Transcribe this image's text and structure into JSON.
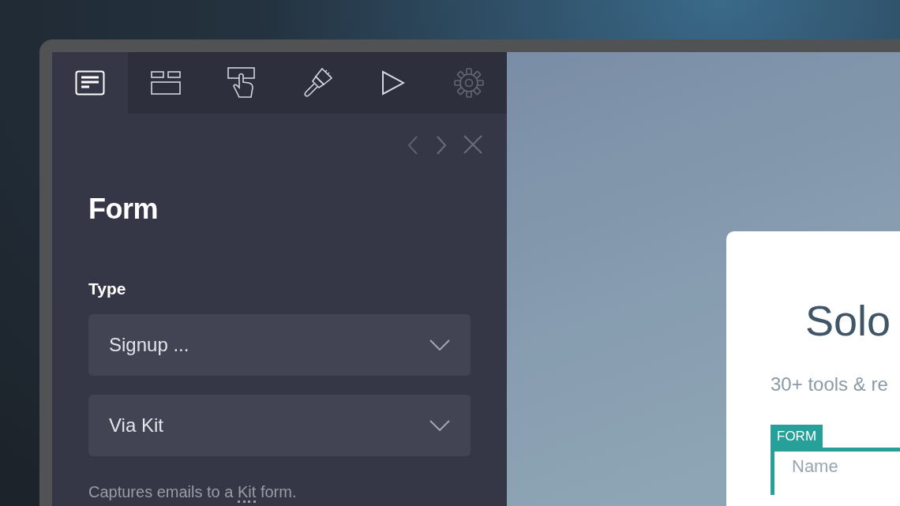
{
  "tabs": [
    {
      "kind": "form",
      "selected": true
    },
    {
      "kind": "layout",
      "selected": false
    },
    {
      "kind": "click",
      "selected": false
    },
    {
      "kind": "brush",
      "selected": false
    },
    {
      "kind": "play",
      "selected": false
    },
    {
      "kind": "settings",
      "selected": false
    }
  ],
  "panel": {
    "title": "Form",
    "type_label": "Type",
    "selects": [
      {
        "value": "Signup ..."
      },
      {
        "value": "Via Kit"
      }
    ],
    "description": {
      "before": "Captures emails to a ",
      "term": "Kit",
      "after": " form."
    }
  },
  "preview": {
    "heading": "Solo",
    "subtitle": "30+ tools & re",
    "form_tag": "FORM",
    "field_placeholder": "Name"
  }
}
